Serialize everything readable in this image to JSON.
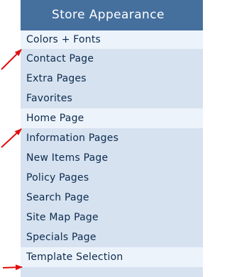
{
  "panel": {
    "title": "Store Appearance",
    "items": [
      {
        "label": "Colors + Fonts",
        "highlighted": true
      },
      {
        "label": "Contact Page",
        "highlighted": false
      },
      {
        "label": "Extra Pages",
        "highlighted": false
      },
      {
        "label": "Favorites",
        "highlighted": false
      },
      {
        "label": "Home Page",
        "highlighted": true
      },
      {
        "label": "Information Pages",
        "highlighted": false
      },
      {
        "label": "New Items Page",
        "highlighted": false
      },
      {
        "label": "Policy Pages",
        "highlighted": false
      },
      {
        "label": "Search Page",
        "highlighted": false
      },
      {
        "label": "Site Map Page",
        "highlighted": false
      },
      {
        "label": "Specials Page",
        "highlighted": false
      },
      {
        "label": "Template Selection",
        "highlighted": true
      }
    ]
  },
  "colors": {
    "header_bg": "#45709e",
    "panel_bg": "#d6e2f0",
    "highlight_bg": "#edf3fa",
    "arrow": "#e01010"
  },
  "annotations": {
    "arrow_count": 3,
    "icon": "red-pointer-arrow"
  }
}
